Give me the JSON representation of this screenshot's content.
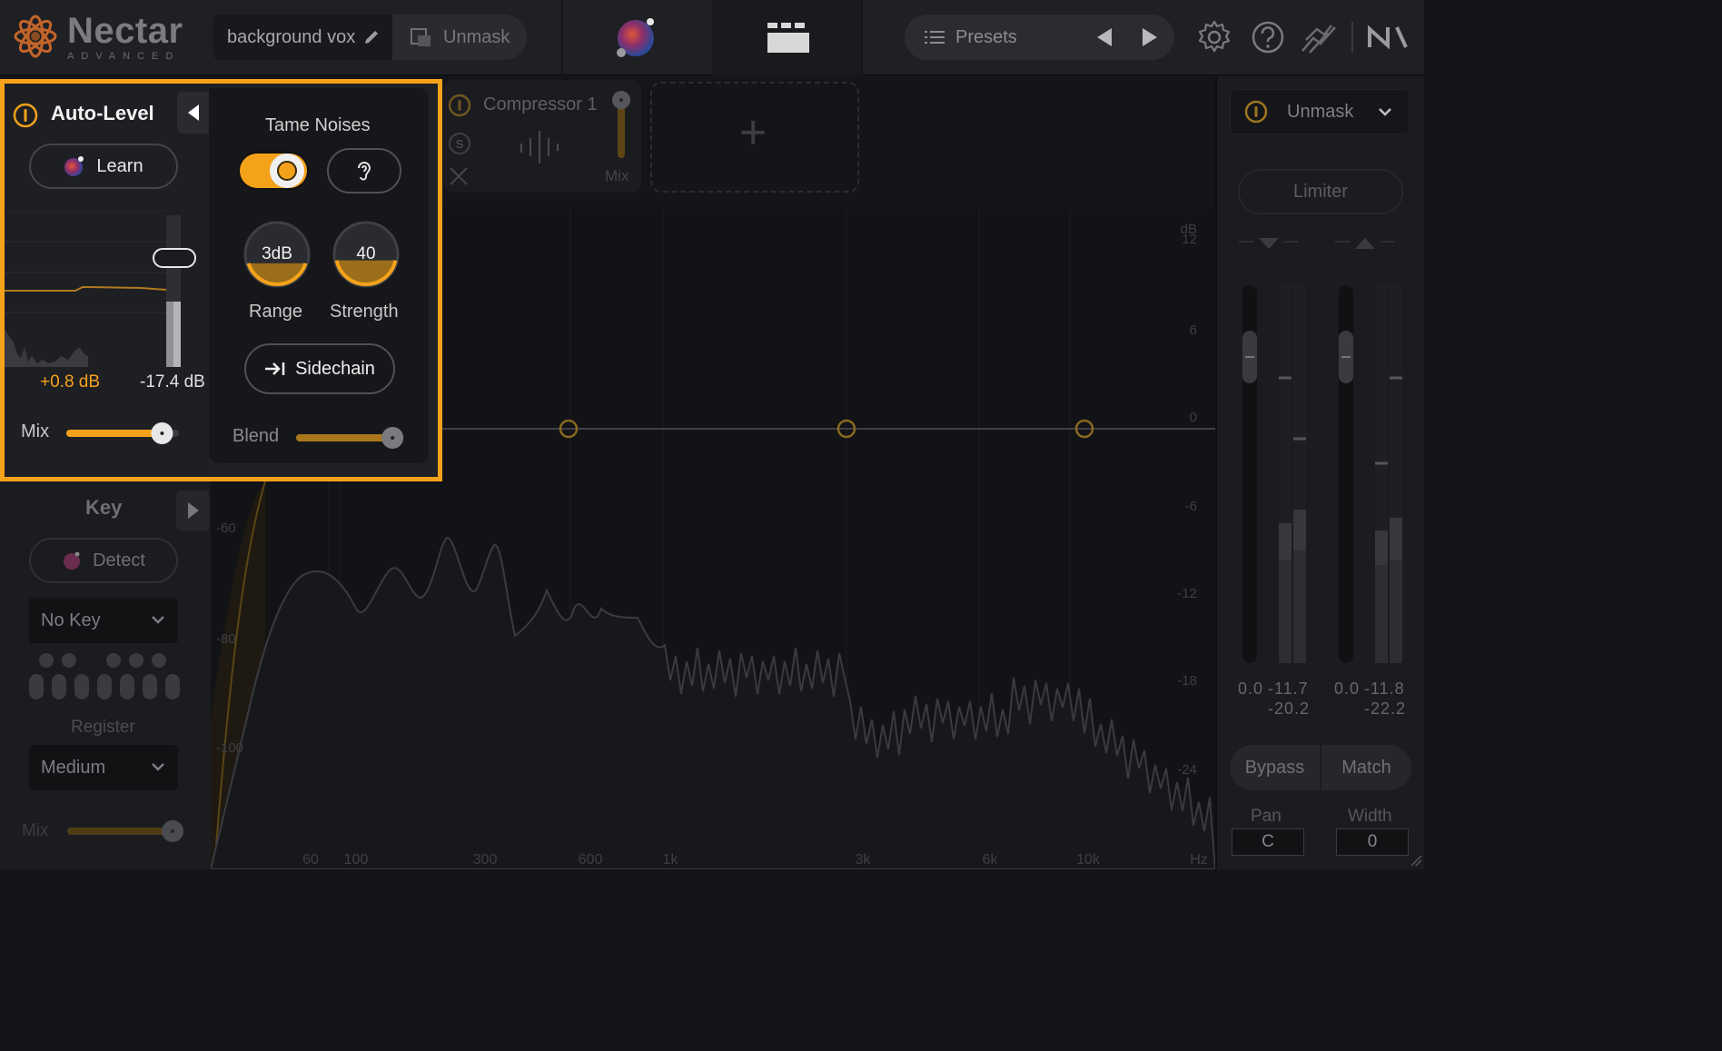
{
  "app": {
    "name": "Nectar",
    "edition": "ADVANCED"
  },
  "header": {
    "preset_name": "background vox",
    "unmask_label": "Unmask",
    "presets_label": "Presets"
  },
  "auto_level": {
    "title": "Auto-Level",
    "learn_label": "Learn",
    "gain_value": "+0.8 dB",
    "input_value": "-17.4 dB",
    "mix_label": "Mix",
    "mix_level": 0.85,
    "tame_noises": {
      "title": "Tame Noises",
      "enabled": true,
      "range_value": "3dB",
      "range_label": "Range",
      "range_level": 0.2,
      "strength_value": "40",
      "strength_label": "Strength",
      "strength_level": 0.4,
      "sidechain_label": "Sidechain",
      "blend_label": "Blend",
      "blend_level": 0.9
    }
  },
  "compressor": {
    "title": "Compressor 1",
    "mix_label": "Mix",
    "solo_label": "S"
  },
  "add_module_symbol": "+",
  "key": {
    "title": "Key",
    "detect_label": "Detect",
    "key_value": "No Key",
    "register_label": "Register",
    "register_value": "Medium",
    "mix_label": "Mix"
  },
  "spectrum": {
    "db_unit": "dB",
    "db_scale": [
      "12",
      "6",
      "0",
      "-6",
      "-12",
      "-18",
      "-24"
    ],
    "left_scale": [
      "-60",
      "-80",
      "-100"
    ],
    "freq_labels": [
      "60",
      "100",
      "300",
      "600",
      "1k",
      "3k",
      "6k",
      "10k",
      "Hz"
    ]
  },
  "output": {
    "unmask_label": "Unmask",
    "limiter_label": "Limiter",
    "meter_left": {
      "peak": "0.0",
      "rms_a": "-11.7",
      "rms_b": "-20.2"
    },
    "meter_right": {
      "peak": "0.0",
      "rms_a": "-11.8",
      "rms_b": "-22.2"
    },
    "bypass_label": "Bypass",
    "match_label": "Match",
    "pan_label": "Pan",
    "pan_value": "C",
    "width_label": "Width",
    "width_value": "0"
  },
  "colors": {
    "accent": "#f5a21b",
    "panel": "#1b1c20",
    "background": "#141518"
  },
  "icons": [
    "nectar-logo-icon",
    "pencil-icon",
    "mask-icon",
    "assistant-orb-icon",
    "module-grid-icon",
    "list-icon",
    "prev-arrow-icon",
    "next-arrow-icon",
    "settings-gear-icon",
    "help-icon",
    "routing-icon",
    "ni-logo-icon",
    "power-icon",
    "ear-icon",
    "sidechain-arrow-icon",
    "chevron-down-icon",
    "collapse-arrow-icon"
  ]
}
